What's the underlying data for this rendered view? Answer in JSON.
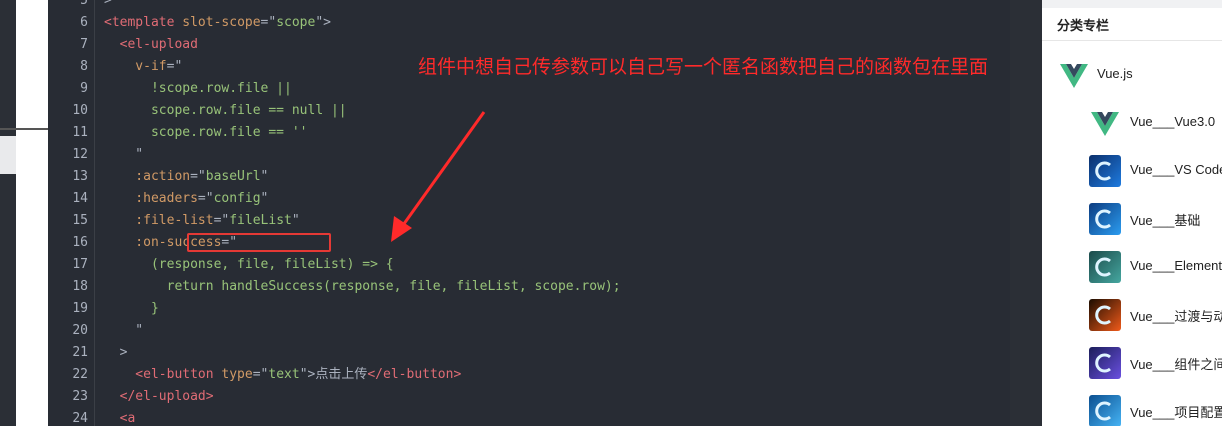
{
  "editor": {
    "lines": [
      {
        "n": "5",
        "parts": [
          {
            "t": ">",
            "c": "plain"
          }
        ]
      },
      {
        "n": "6",
        "parts": [
          {
            "t": "<template",
            "c": "tag"
          },
          {
            "t": " slot-scope",
            "c": "attr"
          },
          {
            "t": "=\"",
            "c": "plain"
          },
          {
            "t": "scope",
            "c": "str"
          },
          {
            "t": "\">",
            "c": "plain"
          }
        ]
      },
      {
        "n": "7",
        "parts": [
          {
            "t": "  <el-upload",
            "c": "tag"
          }
        ]
      },
      {
        "n": "8",
        "parts": [
          {
            "t": "    v-if",
            "c": "attr"
          },
          {
            "t": "=\"",
            "c": "plain"
          }
        ]
      },
      {
        "n": "9",
        "parts": [
          {
            "t": "      !scope.row.file ||",
            "c": "str"
          }
        ]
      },
      {
        "n": "10",
        "parts": [
          {
            "t": "      scope.row.file == null ||",
            "c": "str"
          }
        ]
      },
      {
        "n": "11",
        "parts": [
          {
            "t": "      scope.row.file == ''",
            "c": "str"
          }
        ]
      },
      {
        "n": "12",
        "parts": [
          {
            "t": "    \"",
            "c": "plain"
          }
        ]
      },
      {
        "n": "13",
        "parts": [
          {
            "t": "    :action",
            "c": "attr"
          },
          {
            "t": "=\"",
            "c": "plain"
          },
          {
            "t": "baseUrl",
            "c": "str"
          },
          {
            "t": "\"",
            "c": "plain"
          }
        ]
      },
      {
        "n": "14",
        "parts": [
          {
            "t": "    :headers",
            "c": "attr"
          },
          {
            "t": "=\"",
            "c": "plain"
          },
          {
            "t": "config",
            "c": "str"
          },
          {
            "t": "\"",
            "c": "plain"
          }
        ]
      },
      {
        "n": "15",
        "parts": [
          {
            "t": "    :file-list",
            "c": "attr"
          },
          {
            "t": "=\"",
            "c": "plain"
          },
          {
            "t": "fileList",
            "c": "str"
          },
          {
            "t": "\"",
            "c": "plain"
          }
        ]
      },
      {
        "n": "16",
        "parts": [
          {
            "t": "    :on-success",
            "c": "attr"
          },
          {
            "t": "=\"",
            "c": "plain"
          }
        ]
      },
      {
        "n": "17",
        "parts": [
          {
            "t": "      (response, file, fileList) => {",
            "c": "str"
          }
        ]
      },
      {
        "n": "18",
        "parts": [
          {
            "t": "        return handleSuccess(response, file, fileList, scope.row);",
            "c": "str"
          }
        ]
      },
      {
        "n": "19",
        "parts": [
          {
            "t": "      }",
            "c": "str"
          }
        ]
      },
      {
        "n": "20",
        "parts": [
          {
            "t": "    \"",
            "c": "plain"
          }
        ]
      },
      {
        "n": "21",
        "parts": [
          {
            "t": "  >",
            "c": "plain"
          }
        ]
      },
      {
        "n": "22",
        "parts": [
          {
            "t": "    <el-button",
            "c": "tag"
          },
          {
            "t": " type",
            "c": "attr"
          },
          {
            "t": "=\"",
            "c": "plain"
          },
          {
            "t": "text",
            "c": "str"
          },
          {
            "t": "\">",
            "c": "plain"
          },
          {
            "t": "点击上传",
            "c": "plain"
          },
          {
            "t": "</el-button>",
            "c": "tag"
          }
        ]
      },
      {
        "n": "23",
        "parts": [
          {
            "t": "  </el-upload>",
            "c": "tag"
          }
        ]
      },
      {
        "n": "24",
        "parts": [
          {
            "t": "  <a",
            "c": "tag"
          }
        ]
      }
    ],
    "annotation": "组件中想自己传参数可以自己写一个匿名函数把自己的函数包在里面",
    "annotation_color": "#ff2a2a"
  },
  "sidebar": {
    "title": "分类专栏",
    "items": [
      {
        "label": "Vue.js",
        "icon": "vue-logo-icon"
      },
      {
        "label": "Vue___Vue3.0",
        "icon": "vue-logo-icon"
      },
      {
        "label": "Vue___VS Code",
        "icon": "column-cover-icon"
      },
      {
        "label": "Vue___基础",
        "icon": "column-cover-icon"
      },
      {
        "label": "Vue___Element",
        "icon": "column-cover-icon"
      },
      {
        "label": "Vue___过渡与动画",
        "icon": "column-cover-icon"
      },
      {
        "label": "Vue___组件之间",
        "icon": "column-cover-icon"
      },
      {
        "label": "Vue___项目配置",
        "icon": "column-cover-icon"
      }
    ]
  }
}
